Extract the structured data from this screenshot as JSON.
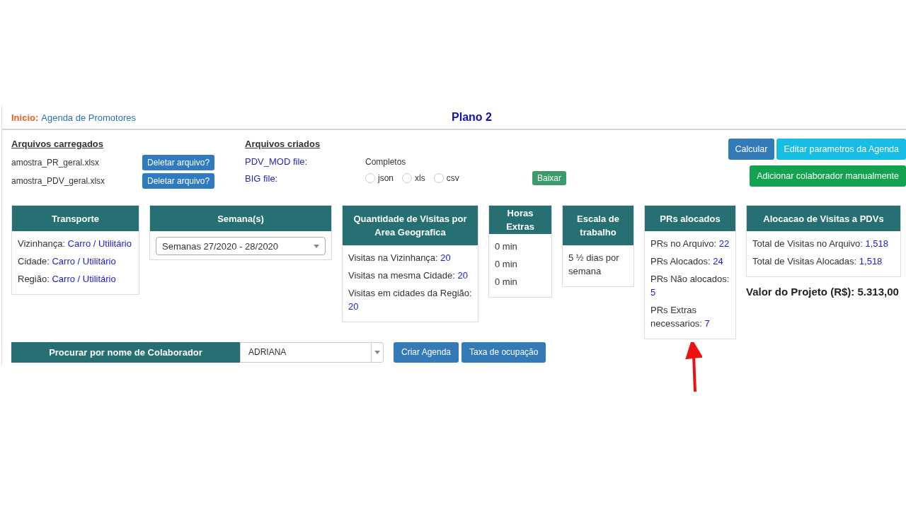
{
  "breadcrumb": {
    "label": "Inicio:",
    "link": "Agenda de Promotores"
  },
  "title": "Plano 2",
  "loaded_files": {
    "heading": "Arquivos carregados",
    "files": [
      {
        "name": "amostra_PR_geral.xlsx",
        "button": "Deletar arquivo?"
      },
      {
        "name": "amostra_PDV_geral.xlsx",
        "button": "Deletar arquivo?"
      }
    ]
  },
  "created_files": {
    "heading": "Arquivos criados",
    "files": [
      {
        "label": "PDV_MOD file:",
        "status": "Completos"
      },
      {
        "label": "BIG file:"
      }
    ],
    "formats": [
      {
        "label": "json",
        "selected": false
      },
      {
        "label": "xls",
        "selected": false
      },
      {
        "label": "csv",
        "selected": false
      }
    ],
    "download_button": "Baixar"
  },
  "actions": [
    {
      "label": "Calcular",
      "kind": "primary"
    },
    {
      "label": "Editar parametros da Agenda",
      "kind": "info"
    },
    {
      "label": "Adicionar colaborador manualmente",
      "kind": "success"
    }
  ],
  "panels": [
    {
      "title": "Transporte",
      "kind": "list",
      "items": [
        {
          "label": "Vizinhança:",
          "value": "Carro / Utilitário"
        },
        {
          "label": "Cidade:",
          "value": "Carro / Utilitário"
        },
        {
          "label": "Região:",
          "value": "Carro / Utilitário"
        }
      ]
    },
    {
      "title": "Semana(s)",
      "kind": "select",
      "value": "Semanas 27/2020 - 28/2020"
    },
    {
      "title": "Quantidade de Visitas por Area Geografica",
      "kind": "list",
      "items": [
        {
          "label": "Visitas na Vizinhança:",
          "value": "20"
        },
        {
          "label": "Visitas na mesma Cidade:",
          "value": "20"
        },
        {
          "label": "Visitas em cidades da Região:",
          "value": "20"
        }
      ]
    },
    {
      "title": "Horas Extras",
      "kind": "list",
      "items": [
        {
          "label": "0 min"
        },
        {
          "label": "0 min"
        },
        {
          "label": "0 min"
        }
      ]
    },
    {
      "title": "Escala de trabalho",
      "kind": "list",
      "items": [
        {
          "label": "5 ½ dias por semana"
        }
      ]
    },
    {
      "title": "PRs alocados",
      "kind": "list",
      "items": [
        {
          "label": "PRs no Arquivo:",
          "value": "22"
        },
        {
          "label": "PRs Alocados:",
          "value": "24"
        },
        {
          "label": "PRs Não alocados:",
          "value": "5"
        },
        {
          "label": "PRs Extras necessarios:",
          "value": "7"
        }
      ]
    },
    {
      "title": "Alocacao de Visitas a PDVs",
      "kind": "list",
      "items": [
        {
          "label": "Total de Visitas no Arquivo:",
          "value": "1,518"
        },
        {
          "label": "Total de Visitas Alocadas:",
          "value": "1,518"
        }
      ],
      "footer": "Valor do Projeto (R$): 5.313,00"
    }
  ],
  "search": {
    "label": "Procurar por nome de Colaborador",
    "value": "ADRIANA",
    "buttons": [
      "Criar Agenda",
      "Taxa de ocupação"
    ]
  }
}
